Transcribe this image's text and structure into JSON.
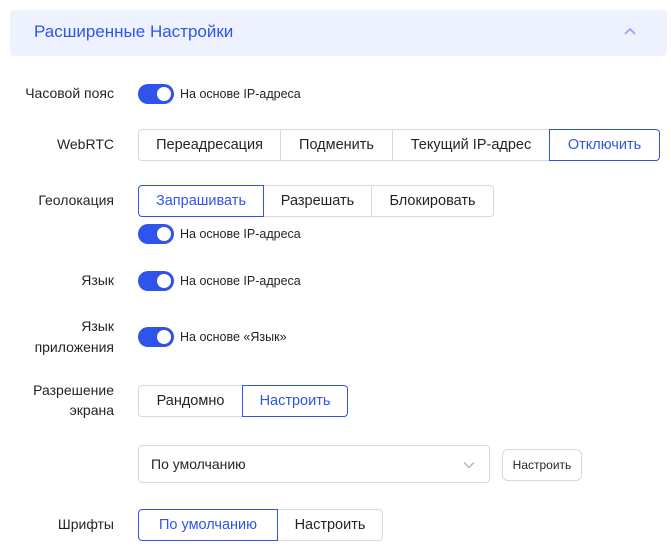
{
  "header": {
    "title": "Расширенные Настройки",
    "collapse_icon": "chevron-up-icon"
  },
  "timezone": {
    "label": "Часовой пояс",
    "toggle_on": true,
    "toggle_label": "На основе IP-адреса"
  },
  "webrtc": {
    "label": "WebRTC",
    "options": [
      "Переадресация",
      "Подменить",
      "Текущий IP-адрес",
      "Отключить"
    ],
    "selected": "Отключить"
  },
  "geolocation": {
    "label": "Геолокация",
    "options": [
      "Запрашивать",
      "Разрешать",
      "Блокировать"
    ],
    "selected": "Запрашивать",
    "toggle_on": true,
    "toggle_label": "На основе IP-адреса"
  },
  "language": {
    "label": "Язык",
    "toggle_on": true,
    "toggle_label": "На основе IP-адреса"
  },
  "app_language": {
    "label_line1": "Язык",
    "label_line2": "приложения",
    "toggle_on": true,
    "toggle_label": "На основе «Язык»"
  },
  "resolution": {
    "label_line1": "Разрешение",
    "label_line2": "экрана",
    "options": [
      "Рандомно",
      "Настроить"
    ],
    "selected": "Настроить",
    "select_value": "По умолчанию",
    "configure_button": "Настроить"
  },
  "fonts": {
    "label": "Шрифты",
    "options": [
      "По умолчанию",
      "Настроить"
    ],
    "selected": "По умолчанию"
  },
  "colors": {
    "accent": "#2f54eb",
    "header_bg": "#eef2ff",
    "border": "#d9d9d9"
  }
}
